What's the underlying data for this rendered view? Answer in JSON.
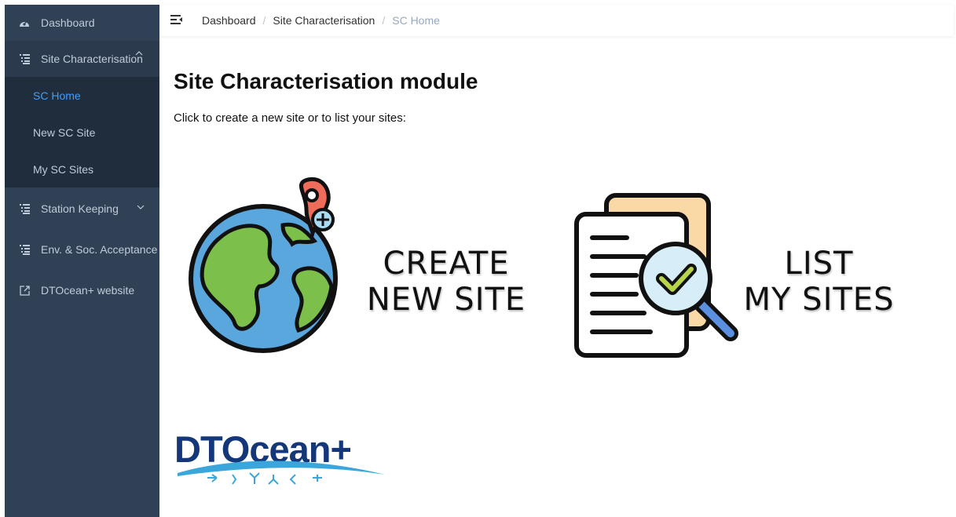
{
  "sidebar": {
    "items": [
      {
        "label": "Dashboard",
        "icon": "dashboard-icon"
      },
      {
        "label": "Site Characterisation",
        "icon": "list-icon",
        "expanded": true,
        "children": [
          {
            "label": "SC Home",
            "active": true
          },
          {
            "label": "New SC Site"
          },
          {
            "label": "My SC Sites"
          }
        ]
      },
      {
        "label": "Station Keeping",
        "icon": "list-icon"
      },
      {
        "label": "Env. & Soc. Acceptance",
        "icon": "list-icon"
      },
      {
        "label": "DTOcean+ website",
        "icon": "external-link-icon"
      }
    ]
  },
  "breadcrumb": [
    "Dashboard",
    "Site Characterisation",
    "SC Home"
  ],
  "breadcrumb_separator": "/",
  "main": {
    "title": "Site Characterisation module",
    "intro": "Click to create a new site or to list your sites:",
    "create_tile": {
      "line1": "CREATE",
      "line2": "NEW SITE"
    },
    "list_tile": {
      "line1": "LIST",
      "line2": "MY SITES"
    },
    "logo_text": "DTOcean+"
  },
  "colors": {
    "sidebar_bg": "#304156",
    "submenu_bg": "#1f2d3d",
    "active_link": "#409eff",
    "logo_blue": "#14377a",
    "wave_blue": "#3aa6dc"
  }
}
